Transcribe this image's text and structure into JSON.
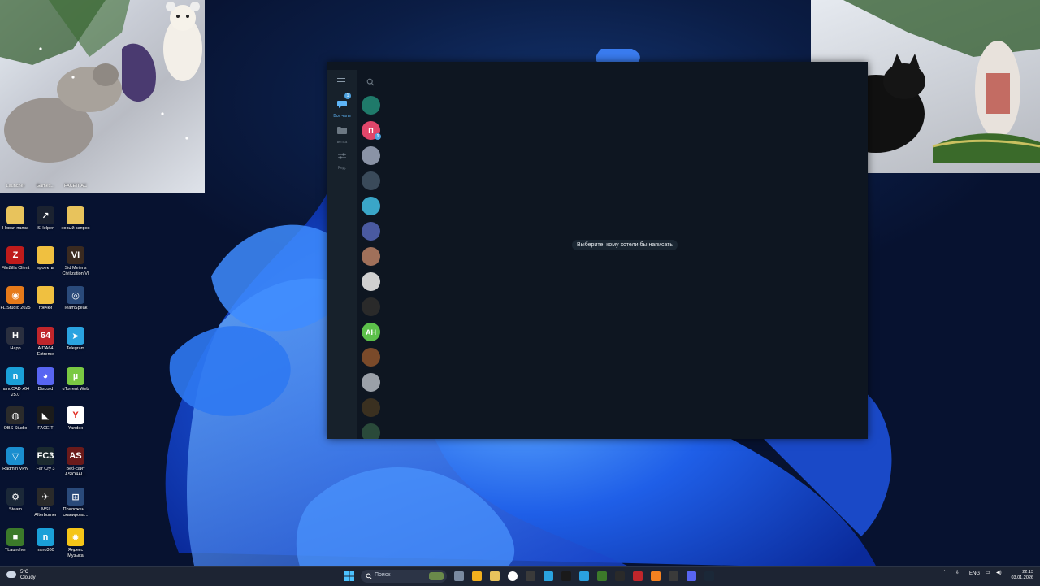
{
  "desktop": {
    "icons": [
      {
        "label": "Launcher",
        "color": "#2b3040",
        "glyph": ""
      },
      {
        "label": "Games...",
        "color": "#2b3040",
        "glyph": ""
      },
      {
        "label": "FACEIT AC",
        "color": "#3a1a10",
        "glyph": "▲"
      },
      {
        "label": "Новая папка",
        "color": "#e8c35c",
        "glyph": ""
      },
      {
        "label": "SHelper",
        "color": "#1b2230",
        "glyph": "↗"
      },
      {
        "label": "новый запрос",
        "color": "#e8c35c",
        "glyph": ""
      },
      {
        "label": "FileZilla Client",
        "color": "#bf1b1b",
        "glyph": "Z"
      },
      {
        "label": "проекты",
        "color": "#f0c040",
        "glyph": ""
      },
      {
        "label": "Sid Meier's Civilization VI",
        "color": "#3a2a20",
        "glyph": "VI"
      },
      {
        "label": "FL Studio 2025",
        "color": "#e67a1a",
        "glyph": "◉"
      },
      {
        "label": "гречки",
        "color": "#f0c040",
        "glyph": ""
      },
      {
        "label": "TeamSpeak",
        "color": "#2a4a7a",
        "glyph": "◎"
      },
      {
        "label": "Happ",
        "color": "#2a2f3f",
        "glyph": "H"
      },
      {
        "label": "AIDA64 Extreme",
        "color": "#c0262b",
        "glyph": "64"
      },
      {
        "label": "Telegram",
        "color": "#2aa3e0",
        "glyph": "➤"
      },
      {
        "label": "nanoCAD x64 25.0",
        "color": "#1aa0d8",
        "glyph": "n"
      },
      {
        "label": "Discord",
        "color": "#5865f2",
        "glyph": "◕"
      },
      {
        "label": "uTorrent Web",
        "color": "#7ac943",
        "glyph": "µ"
      },
      {
        "label": "OBS Studio",
        "color": "#2b2b2b",
        "glyph": "◍"
      },
      {
        "label": "FACEIT",
        "color": "#1b1b1b",
        "glyph": "◣"
      },
      {
        "label": "Yandex",
        "color": "#ffffff",
        "glyph": "Y"
      },
      {
        "label": "Radmin VPN",
        "color": "#1a8ecf",
        "glyph": "▽"
      },
      {
        "label": "Far Cry 3",
        "color": "#1b2a2f",
        "glyph": "FC3"
      },
      {
        "label": "Веб-сайт ASIO4ALL",
        "color": "#6a1a1a",
        "glyph": "AS"
      },
      {
        "label": "Steam",
        "color": "#1b2838",
        "glyph": "⚙"
      },
      {
        "label": "MSI Afterburner",
        "color": "#2a2a2a",
        "glyph": "✈"
      },
      {
        "label": "Приложен... сканирова...",
        "color": "#2a4a7a",
        "glyph": "⊞"
      },
      {
        "label": "TLauncher",
        "color": "#3c7a2a",
        "glyph": "■"
      },
      {
        "label": "nano360",
        "color": "#1aa0d8",
        "glyph": "n"
      },
      {
        "label": "Яндекс Музыка",
        "color": "#f5c518",
        "glyph": "✹"
      }
    ]
  },
  "telegram": {
    "rail": {
      "all_chats_label": "Все чаты",
      "all_chats_badge": "1",
      "folder_label": "ветка",
      "edit_label": "Ред."
    },
    "chats": [
      {
        "initials": "",
        "color": "#1f7a6a",
        "badge": ""
      },
      {
        "initials": "П",
        "color": "#e0466a",
        "badge": "1"
      },
      {
        "initials": "",
        "color": "#8a93a6",
        "badge": ""
      },
      {
        "initials": "",
        "color": "#3a4a5a",
        "badge": ""
      },
      {
        "initials": "",
        "color": "#3aa6c8",
        "badge": ""
      },
      {
        "initials": "",
        "color": "#4a5aa0",
        "badge": ""
      },
      {
        "initials": "",
        "color": "#a0705a",
        "badge": ""
      },
      {
        "initials": "",
        "color": "#d0d0d0",
        "badge": ""
      },
      {
        "initials": "",
        "color": "#2a2a2a",
        "badge": ""
      },
      {
        "initials": "АН",
        "color": "#5cc04a",
        "badge": ""
      },
      {
        "initials": "",
        "color": "#7a4a2a",
        "badge": ""
      },
      {
        "initials": "",
        "color": "#9aa0a8",
        "badge": ""
      },
      {
        "initials": "",
        "color": "#3a3020",
        "badge": ""
      },
      {
        "initials": "",
        "color": "#2a4a3a",
        "badge": ""
      }
    ],
    "empty_state": "Выберите, кому хотели бы написать"
  },
  "taskbar": {
    "weather_temp": "5°C",
    "weather_desc": "Cloudy",
    "search_placeholder": "Поиск",
    "language": "ENG",
    "time": "22:13",
    "date": "03.01.2026",
    "apps": [
      "#7a8aa0",
      "#f2b01e",
      "#e8c35c",
      "#ffffff",
      "#3a3a3a",
      "#2aa3e0",
      "#1a1a1a",
      "#2aa0e0",
      "#3c7a2a",
      "#2a2a2a",
      "#c0262b",
      "#f58220",
      "#3a3a3a",
      "#5865f2",
      "#1b2838"
    ]
  }
}
